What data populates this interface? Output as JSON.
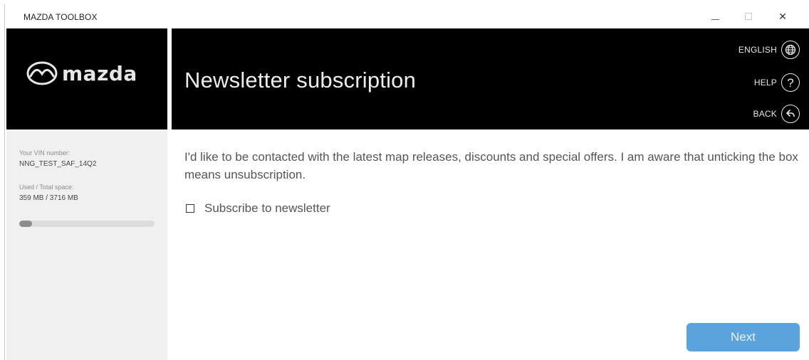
{
  "window": {
    "title": "MAZDA TOOLBOX",
    "controls": {
      "minimize_icon": "minimize-icon",
      "maximize_icon": "maximize-icon",
      "close_glyph": "✕"
    }
  },
  "brand": {
    "logo_text": "mazda",
    "logo_icon": "mazda-emblem-icon"
  },
  "sidebar": {
    "vin_label": "Your VIN number:",
    "vin_value": "NNG_TEST_SAF_14Q2",
    "space_label": "Used / Total space:",
    "space_value": "359 MB / 3716 MB",
    "space_used_fraction": 0.097
  },
  "header": {
    "title": "Newsletter subscription",
    "links": [
      {
        "label": "ENGLISH",
        "icon": "globe-icon"
      },
      {
        "label": "HELP",
        "icon": "help-icon",
        "glyph": "?"
      },
      {
        "label": "BACK",
        "icon": "back-icon"
      }
    ]
  },
  "content": {
    "intro": "I'd like to be contacted with the latest map releases, discounts and special offers. I am aware that unticking the box means unsubscription.",
    "checkbox_label": "Subscribe to newsletter",
    "checkbox_checked": false
  },
  "footer": {
    "next_label": "Next"
  },
  "colors": {
    "accent": "#5aa3dc",
    "header_bg": "#000000",
    "sidebar_bg": "#f0f0f0"
  }
}
